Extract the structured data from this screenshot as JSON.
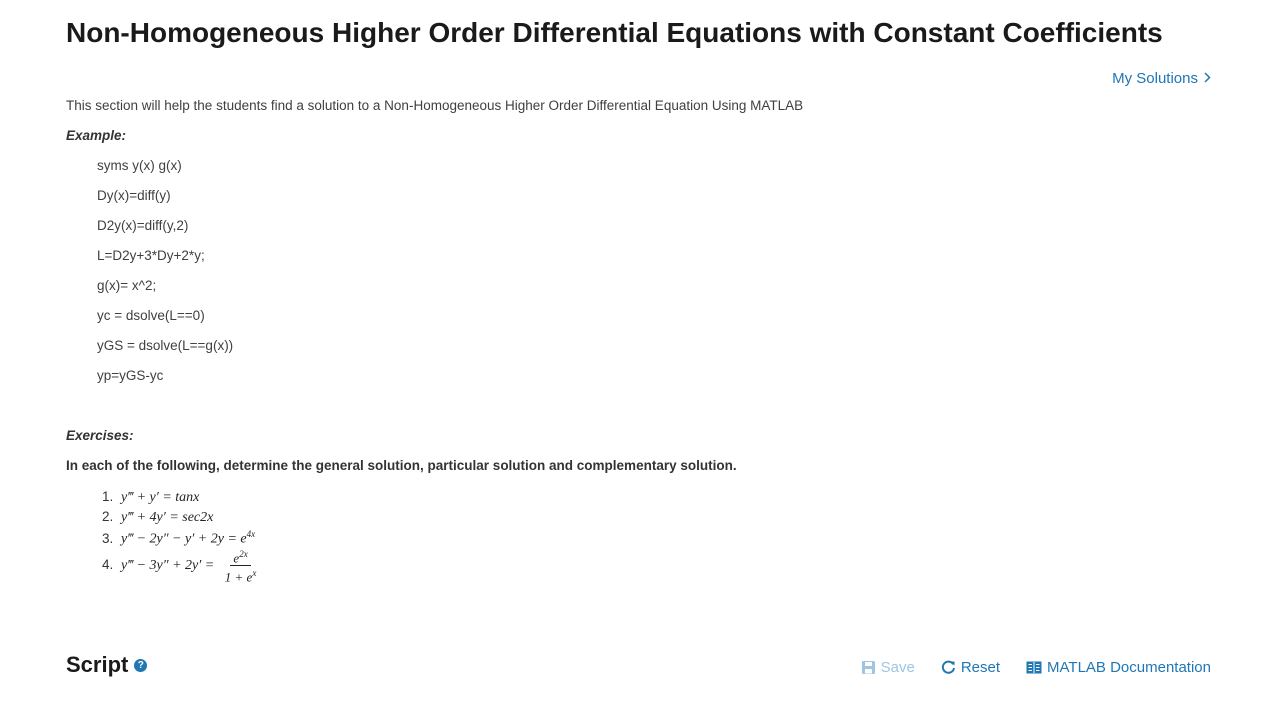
{
  "page": {
    "title": "Non-Homogeneous Higher Order Differential Equations with Constant Coefficients",
    "my_solutions_label": "My Solutions",
    "intro": "This section will help the students find a solution to a Non-Homogeneous Higher Order Differential Equation Using MATLAB"
  },
  "example": {
    "label": "Example:",
    "code_lines": [
      "syms y(x) g(x)",
      "Dy(x)=diff(y)",
      "D2y(x)=diff(y,2)",
      "L=D2y+3*Dy+2*y;",
      "g(x)= x^2;",
      "yc = dsolve(L==0)",
      "yGS = dsolve(L==g(x))",
      "yp=yGS-yc"
    ]
  },
  "exercises": {
    "label": "Exercises:",
    "instruction": "In each of the following, determine the general solution, particular solution and complementary solution.",
    "items": [
      {
        "num": "1.",
        "lhs": "y‴ + y′ = ",
        "rhs": "tanx"
      },
      {
        "num": "2.",
        "lhs": "y‴ + 4y′ = ",
        "rhs": "sec2x"
      },
      {
        "num": "3.",
        "lhs": "y‴ − 2y″ − y′ + 2y = ",
        "rhs_base": "e",
        "rhs_sup": "4x"
      },
      {
        "num": "4.",
        "lhs": "y‴ − 3y″ + 2y′ = ",
        "frac_num_base": "e",
        "frac_num_sup": "2x",
        "frac_den_pre": "1 + ",
        "frac_den_base": "e",
        "frac_den_sup": "x"
      }
    ]
  },
  "script": {
    "title": "Script",
    "save_label": "Save",
    "reset_label": "Reset",
    "doc_label": "MATLAB Documentation"
  },
  "colors": {
    "link": "#1f77b4",
    "disabled": "#9ec5e5",
    "text": "#404040",
    "heading": "#1a1a1a"
  },
  "icons": [
    "chevron-right-icon",
    "help-icon",
    "save-icon",
    "reset-icon",
    "book-icon"
  ]
}
